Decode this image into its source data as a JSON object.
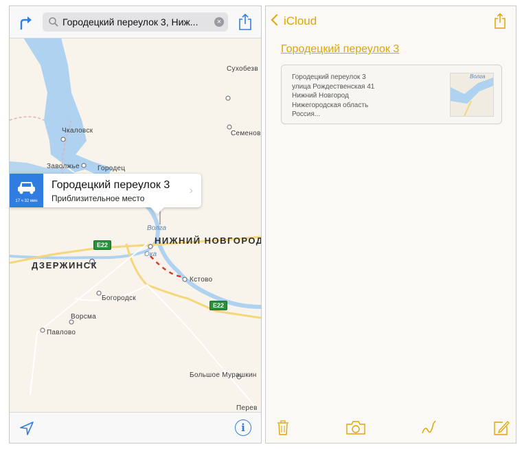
{
  "maps": {
    "search": {
      "query": "Городецкий переулок 3, Ниж..."
    },
    "callout": {
      "title": "Городецкий переулок 3",
      "subtitle": "Приблизительное место",
      "eta": "17 ч 32 мин"
    },
    "labels": {
      "sukhobez": "Сухобезв",
      "chkalovsk": "Чкаловск",
      "semenov": "Семенов",
      "zavolzhye": "Заволжье",
      "gorodets": "Городец",
      "nizhny": "НИЖНИЙ НОВГОРОД",
      "dzerzhinsk": "ДЗЕРЖИНСК",
      "kstovo": "Кстово",
      "bogorodsk": "Богородск",
      "vorsma": "Ворсма",
      "pavlovo": "Павлово",
      "murashkino": "Большое Мурашкин",
      "perev": "Перев",
      "volga": "Волга",
      "oka": "Ока",
      "e22a": "E22",
      "e22b": "E22"
    },
    "colors": {
      "accent": "#2f7de1",
      "water": "#aed2f0",
      "land": "#f8f4ec",
      "pin": "#e23a35"
    }
  },
  "notes": {
    "back_label": "iCloud",
    "note_title": "Городецкий переулок 3",
    "card": {
      "lines": [
        "Городецкий переулок 3",
        "улица Рождественская 41",
        "Нижний Новгород",
        "Нижегородская область",
        "Россия..."
      ],
      "thumb_label": "Волга"
    },
    "colors": {
      "accent": "#e0a500"
    }
  }
}
